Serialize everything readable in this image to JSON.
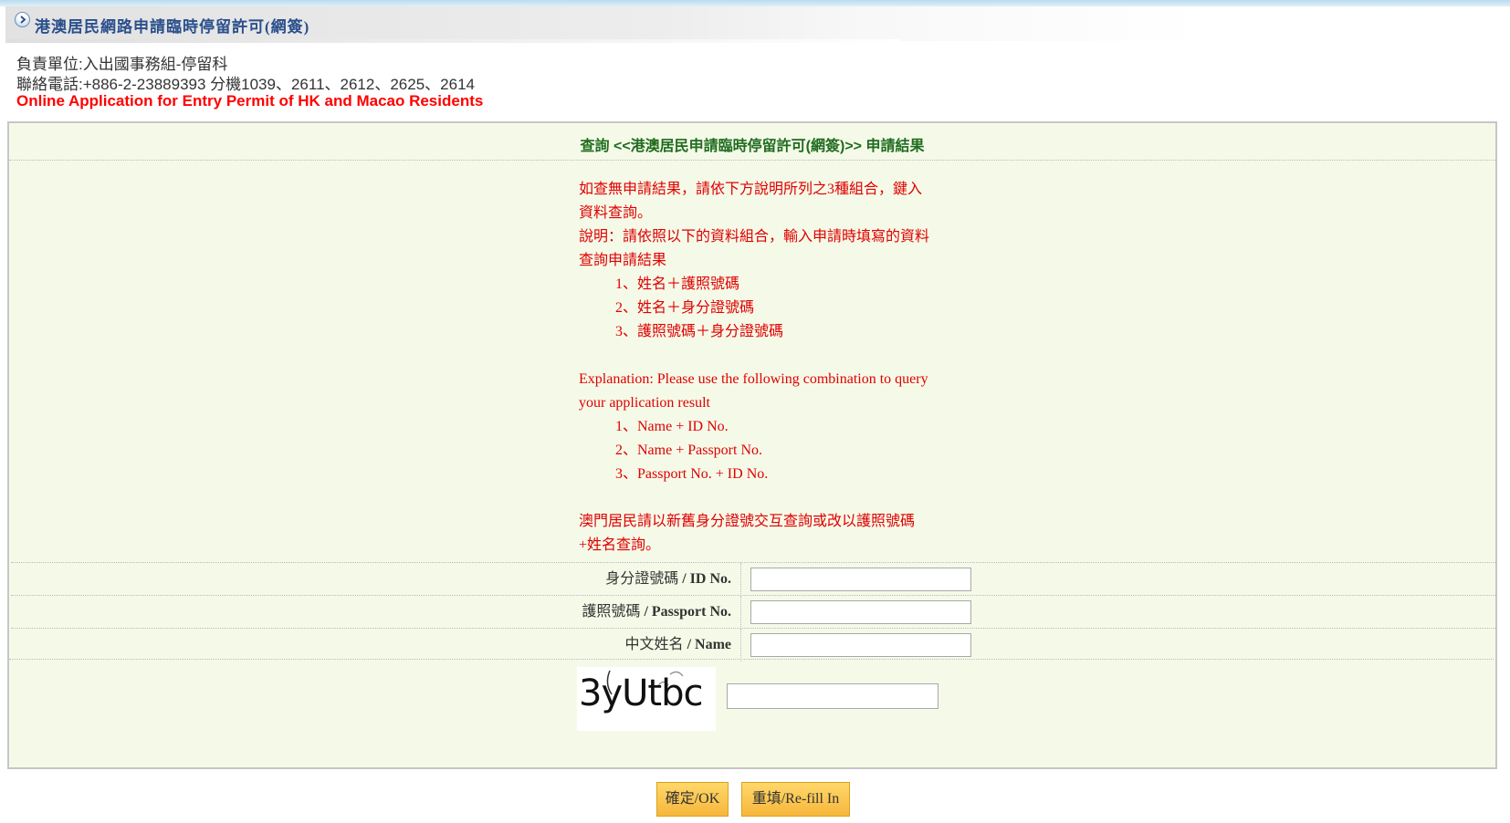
{
  "header": {
    "title": "港澳居民網路申請臨時停留許可(網簽)",
    "department": "負責單位:入出國事務組-停留科",
    "phone": "聯絡電話:+886-2-23889393 分機1039、2611、2612、2625、2614",
    "english_title": "Online Application for Entry Permit of HK and Macao Residents"
  },
  "panel": {
    "title": "查詢 <<港澳居民申請臨時停留許可(網簽)>> 申請結果"
  },
  "notes": {
    "zh_intro_1": "如查無申請結果，請依下方說明所列之3種組合，鍵入",
    "zh_intro_2": "資料查詢。",
    "zh_explain_1": "說明：請依照以下的資料組合，輸入申請時填寫的資料",
    "zh_explain_2": "查詢申請結果",
    "zh_items": [
      "1、姓名＋護照號碼",
      "2、姓名＋身分證號碼",
      "3、護照號碼＋身分證號碼"
    ],
    "en_explain_1": "Explanation: Please use the following combination to query",
    "en_explain_2": "your application result",
    "en_items": [
      "1、Name + ID No.",
      "2、Name + Passport No.",
      "3、Passport No. + ID No."
    ],
    "macao_1": "澳門居民請以新舊身分證號交互查詢或改以護照號碼",
    "macao_2": "+姓名查詢。"
  },
  "form": {
    "id_label_cn": "身分證號碼",
    "id_label_en": "/ ID No.",
    "id_value": "",
    "passport_label_cn": "護照號碼",
    "passport_label_en": "/ Passport No.",
    "passport_value": "",
    "name_label_cn": "中文姓名",
    "name_label_en": "/ Name",
    "name_value": "",
    "captcha_text": "3yUtbc",
    "captcha_value": ""
  },
  "buttons": {
    "ok": "確定/OK",
    "refill": "重填/Re-fill In"
  },
  "colors": {
    "title_blue": "#2a4f8c",
    "notice_red": "#e00000",
    "panel_title_green": "#1f6b1f",
    "panel_bg": "#f5fae8",
    "button_gold": "#f6b73c"
  }
}
